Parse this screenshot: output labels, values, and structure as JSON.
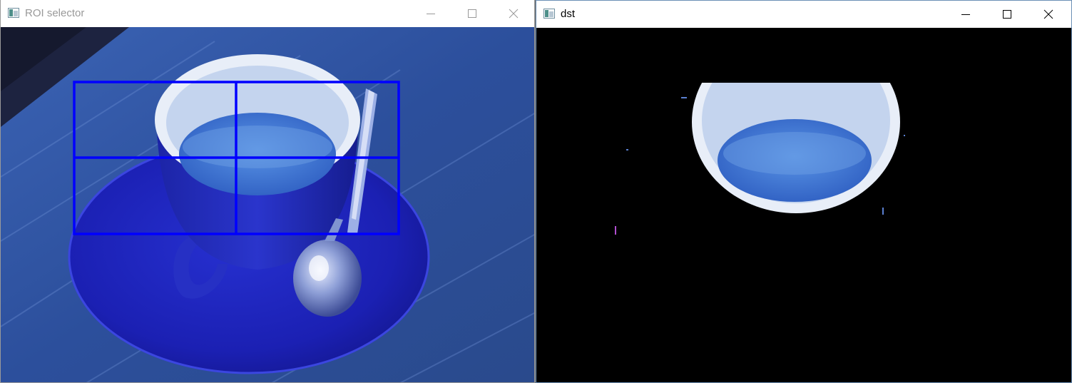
{
  "windows": {
    "roi": {
      "title": "ROI selector",
      "controls": [
        "minimize",
        "maximize",
        "close"
      ],
      "canvas_content": "photo-of-blue-espresso-cup-on-saucer",
      "grid": {
        "rows": 2,
        "cols": 2,
        "color": "#0000ff"
      }
    },
    "dst": {
      "title": "dst",
      "controls": [
        "minimize",
        "maximize",
        "close"
      ],
      "canvas_content": "masked-cup-interior-on-black",
      "background": "#000000"
    }
  },
  "colors": {
    "grid_line": "#0000ff",
    "table": "#2e4f96",
    "saucer": "#1b1fb8",
    "cup_rim": "#e8eef8",
    "coffee": "#3f78d6"
  },
  "icons": [
    "app-icon",
    "minimize-icon",
    "maximize-icon",
    "close-icon"
  ]
}
